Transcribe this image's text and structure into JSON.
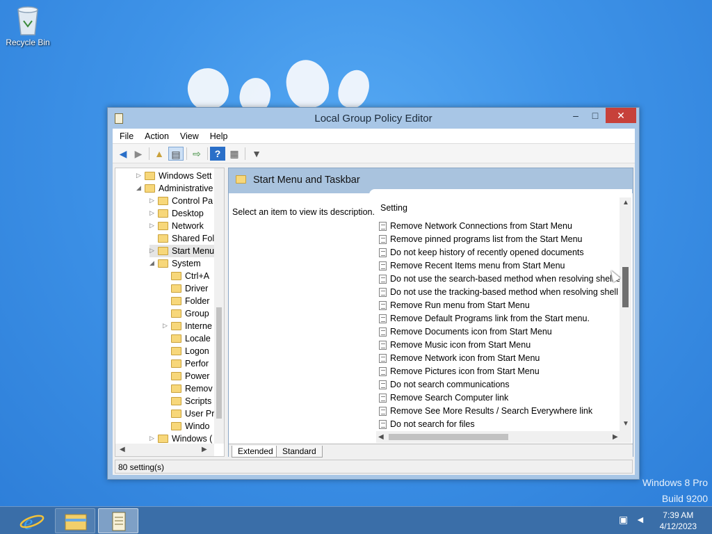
{
  "desktop": {
    "recycle_bin_label": "Recycle Bin",
    "watermark_line1": "Windows 8 Pro",
    "watermark_line2": "Build 9200"
  },
  "window": {
    "title": "Local Group Policy Editor",
    "menu": [
      "File",
      "Action",
      "View",
      "Help"
    ]
  },
  "tree": [
    {
      "label": "Windows Sett",
      "arrow": "▷",
      "indent": 1
    },
    {
      "label": "Administrative",
      "arrow": "◢",
      "indent": 1
    },
    {
      "label": "Control Pa",
      "arrow": "▷",
      "indent": 2
    },
    {
      "label": "Desktop",
      "arrow": "▷",
      "indent": 2
    },
    {
      "label": "Network",
      "arrow": "▷",
      "indent": 2
    },
    {
      "label": "Shared Fol",
      "arrow": "",
      "indent": 2
    },
    {
      "label": "Start Menu",
      "arrow": "▷",
      "indent": 2,
      "selected": true
    },
    {
      "label": "System",
      "arrow": "◢",
      "indent": 2
    },
    {
      "label": "Ctrl+A",
      "arrow": "",
      "indent": 3
    },
    {
      "label": "Driver",
      "arrow": "",
      "indent": 3
    },
    {
      "label": "Folder",
      "arrow": "",
      "indent": 3
    },
    {
      "label": "Group",
      "arrow": "",
      "indent": 3
    },
    {
      "label": "Interne",
      "arrow": "▷",
      "indent": 3
    },
    {
      "label": "Locale",
      "arrow": "",
      "indent": 3
    },
    {
      "label": "Logon",
      "arrow": "",
      "indent": 3
    },
    {
      "label": "Perfor",
      "arrow": "",
      "indent": 3
    },
    {
      "label": "Power",
      "arrow": "",
      "indent": 3
    },
    {
      "label": "Remov",
      "arrow": "",
      "indent": 3
    },
    {
      "label": "Scripts",
      "arrow": "",
      "indent": 3
    },
    {
      "label": "User Pr",
      "arrow": "",
      "indent": 3
    },
    {
      "label": "Windo",
      "arrow": "",
      "indent": 3
    },
    {
      "label": "Windows (",
      "arrow": "▷",
      "indent": 2
    }
  ],
  "details": {
    "header_title": "Start Menu and Taskbar",
    "description_hint": "Select an item to view its description.",
    "column_setting": "Setting",
    "settings": [
      "Remove Network Connections from Start Menu",
      "Remove pinned programs list from the Start Menu",
      "Do not keep history of recently opened documents",
      "Remove Recent Items menu from Start Menu",
      "Do not use the search-based method when resolving shell s...",
      "Do not use the tracking-based method when resolving shell ...",
      "Remove Run menu from Start Menu",
      "Remove Default Programs link from the Start menu.",
      "Remove Documents icon from Start Menu",
      "Remove Music icon from Start Menu",
      "Remove Network icon from Start Menu",
      "Remove Pictures icon from Start Menu",
      "Do not search communications",
      "Remove Search Computer link",
      "Remove See More Results / Search Everywhere link",
      "Do not search for files"
    ],
    "tabs": [
      "Extended",
      "Standard"
    ]
  },
  "status": {
    "text": "80 setting(s)"
  },
  "taskbar": {
    "time": "7:39 AM",
    "date": "4/12/2023"
  }
}
